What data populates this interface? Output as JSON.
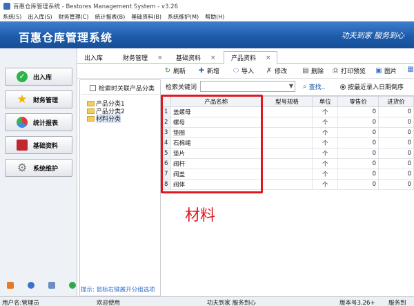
{
  "window": {
    "title": "百惠仓库管理系统 - Bestores Management System - v3.26"
  },
  "menu": [
    "系统(S)",
    "出入库(S)",
    "财务管理(C)",
    "统计报表(B)",
    "基础资料(B)",
    "系统维护(M)",
    "帮助(H)"
  ],
  "banner": {
    "brand": "百惠仓库管理系统",
    "slogan": "功夫到家 服务到心"
  },
  "sidebar": {
    "items": [
      {
        "label": "出入库",
        "icon": "check-circle-icon"
      },
      {
        "label": "财务管理",
        "icon": "star-icon"
      },
      {
        "label": "统计报表",
        "icon": "pie-chart-icon"
      },
      {
        "label": "基础资料",
        "icon": "book-icon"
      },
      {
        "label": "系统维护",
        "icon": "gear-icon"
      }
    ]
  },
  "tabs": [
    {
      "label": "出入库",
      "closable": false
    },
    {
      "label": "财务管理",
      "closable": true
    },
    {
      "label": "基础资料",
      "closable": true
    },
    {
      "label": "产品资料",
      "closable": true
    }
  ],
  "toolbar": {
    "refresh": "刷新",
    "add": "新增",
    "import": "导入",
    "edit": "修改",
    "delete": "删除",
    "print_preview": "打印预览",
    "image": "图片"
  },
  "tree": {
    "link_checkbox": "检索时关联产品分类",
    "nodes": [
      "产品分类1",
      "产品分类2",
      "材料分类"
    ]
  },
  "search": {
    "label": "检索关键词",
    "value": "",
    "button": "查找..",
    "sort_option": "按最近录入日期倒序"
  },
  "grid": {
    "columns": [
      "",
      "产品名称",
      "型号规格",
      "单位",
      "零售价",
      "进货价"
    ],
    "rows": [
      {
        "n": "1",
        "name": "盖螺母",
        "spec": "",
        "unit": "个",
        "retail": "0",
        "purchase": "0"
      },
      {
        "n": "2",
        "name": "螺母",
        "spec": "",
        "unit": "个",
        "retail": "0",
        "purchase": "0"
      },
      {
        "n": "3",
        "name": "垫圈",
        "spec": "",
        "unit": "个",
        "retail": "0",
        "purchase": "0"
      },
      {
        "n": "4",
        "name": "石棉绳",
        "spec": "",
        "unit": "个",
        "retail": "0",
        "purchase": "0"
      },
      {
        "n": "5",
        "name": "垫片",
        "spec": "",
        "unit": "个",
        "retail": "0",
        "purchase": "0"
      },
      {
        "n": "6",
        "name": "阀杆",
        "spec": "",
        "unit": "个",
        "retail": "0",
        "purchase": "0"
      },
      {
        "n": "7",
        "name": "阀盖",
        "spec": "",
        "unit": "个",
        "retail": "0",
        "purchase": "0"
      },
      {
        "n": "8",
        "name": "阀体",
        "spec": "",
        "unit": "个",
        "retail": "0",
        "purchase": "0"
      }
    ]
  },
  "annotation": "材料",
  "tip": "提示: 鼠标右键展开分组选项",
  "status": {
    "user": "用户名:管理员",
    "welcome": "欢迎使用",
    "motto": "功夫到家 服务到心",
    "version": "版本号3.26+",
    "service": "服务到"
  },
  "colors": {
    "banner": "#1c5aa8",
    "highlight": "#e0171d",
    "tip": "#2a6fc8"
  }
}
